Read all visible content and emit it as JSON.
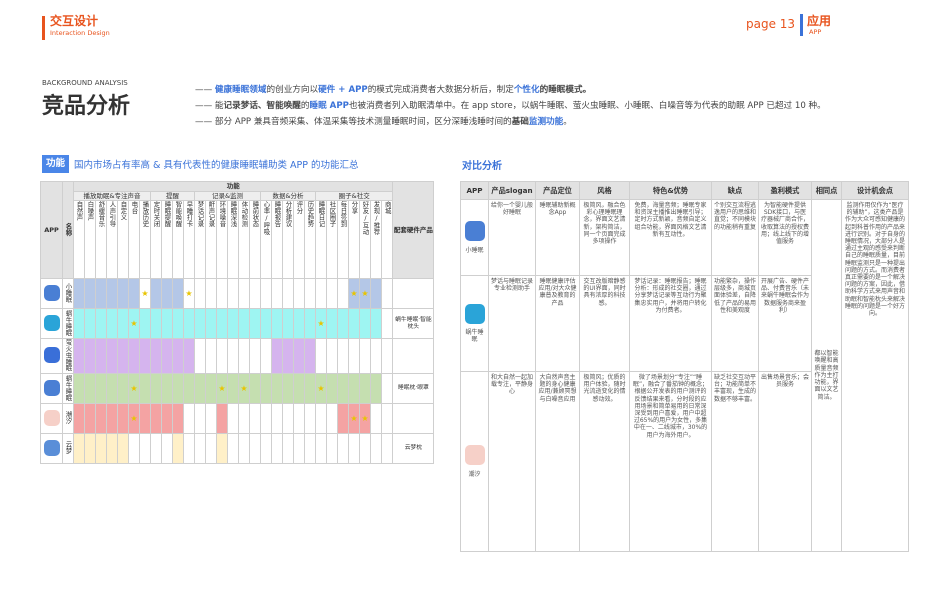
{
  "brand": {
    "title": "交互设计",
    "subtitle": "Interaction Design"
  },
  "page": {
    "label": "page 13",
    "section": "应用",
    "section_en": "APP"
  },
  "heading": {
    "en": "BACKGROUND ANALYSIS",
    "zh": "竞品分析"
  },
  "intro": {
    "l1": {
      "dash": "——",
      "p1": "健康睡眠领域",
      "p2": "的创业方向以",
      "p3": "硬件 + APP",
      "p4": "的模式完成消费者大数据分析后，制定",
      "p5": "个性化",
      "p6": "的睡眠模式。"
    },
    "l2": {
      "dash": "——",
      "p1": "能",
      "p2": "记录梦话、智能唤醒",
      "p3": "的",
      "p4": "睡眠 APP",
      "p5": "也被消费者列入助眠清单中。在 app store，以蜗牛睡眠、萤火虫睡眠、小睡眠、白噪音等为代表的助眠 APP 已超过 10 种。"
    },
    "l3": {
      "dash": "——",
      "p1": "部分 APP 兼具音频采集、体温采集等技术测量睡眠时间，区分深睡浅睡时间的",
      "p2": "基础",
      "p3": "监测功能",
      "p4": "。"
    }
  },
  "left": {
    "tag": "功能",
    "title": "国内市场占有率高 & 具有代表性的健康睡眠辅助类 APP 的功能汇总",
    "app_header": "APP",
    "name_header": "名称",
    "func_header": "功能",
    "support_header": "配套硬件产品",
    "groups": [
      "播放助眠&专注声音",
      "提醒",
      "记录&监测",
      "数据&分析",
      "圈子&社交"
    ],
    "cols": [
      "自然声",
      "白噪声",
      "舒缓音乐",
      "人声引导",
      "自定义",
      "电台",
      "播放历史",
      "定时关闭",
      "睡眠提醒",
      "智能唤醒",
      "早睡打卡",
      "梦话记录",
      "鼾声记录",
      "环境噪音",
      "睡眠深浅",
      "体动检测",
      "睡前状态",
      "心率/呼吸",
      "睡眠报告",
      "分析建议",
      "评分",
      "历史趋势",
      "睡眠日记",
      "社区圈子",
      "每日签到",
      "分享",
      "好友/互动",
      "发现/推荐",
      "商城"
    ],
    "rows": [
      {
        "name": "小睡眠",
        "support": ""
      },
      {
        "name": "蜗牛睡眠",
        "support": "蜗牛睡眠·智能枕头"
      },
      {
        "name": "萤火虫睡眠",
        "support": ""
      },
      {
        "name": "蜗牛睡眠",
        "support": "睡眠枕·眼罩"
      },
      {
        "name": "潮汐",
        "support": ""
      },
      {
        "name": "云梦",
        "support": "云梦枕"
      }
    ]
  },
  "right": {
    "title": "对比分析",
    "headers": [
      "APP",
      "产品slogan",
      "产品定位",
      "风格",
      "特色&优势",
      "缺点",
      "盈利模式",
      "相同点",
      "设计机会点"
    ],
    "rows": [
      {
        "app": "小睡眠",
        "slogan": "给你一个婴儿般好睡眠",
        "position": "睡眠辅助新概念App",
        "style": "极简风，融合色彩心理睡眠理念，界面文艺清新，架构简洁，同一个页面完成多项操作",
        "feature": "免费，海量音频；睡眠专家和资深主播推出睡眠引导；定时方式新颖，音频自定义组合功能，界面风格文艺清新有互动性。",
        "weak": "个别交互流程逃逸用户的思维和直觉；不同模块的功能稍有重复",
        "profit": "为智能硬件提供SDK接口，与医疗器械厂商合作，收取算法的授权费用；线上线下的增值服务",
        "same": "都以智能唤醒和高质量音频作为主打功能，界面以文艺简洁。",
        "chance": "监测作用仅作为“医疗的辅助”，这类产品是作为大众可感知健康的起到科普作用的产品来进行识别。对于自身的睡眠情况，大部分人是通过主观的感受来判断自己的睡眠质量，目前睡眠监测只是一种提出问题的方式。而消费者真正需要的是一个解决问题的方案，因此，借助科学方式来用声音和助眠和智能枕头来解决睡眠的问题是一个好方向。"
      },
      {
        "app": "蜗牛睡眠",
        "slogan": "梦话与睡眠记录专业检测助手",
        "position": "睡眠健康评估应用/对大众健康普及教育的产品",
        "style": "交互改版暗静感的UI界面，同时具有浓厚的科技感。",
        "feature": "梦话记录：睡眠报告；睡眠分析：形成的社交圈，通过分享梦话记录等互动行为聚集忠实用户，并将用户转化为付费者。",
        "weak": "功能繁杂，操作层级多，商城页面体验差，自降低了产品的易用性和美观度",
        "profit": "开展广告、硬件产品、付费音乐（未来蜗牛睡眠会作为数据服务商来盈利）",
        "same": "",
        "chance": ""
      },
      {
        "app": "潮汐",
        "slogan": "和大自然一起加载专注，平静身心",
        "position": "大自然声音主题的身心健康应用/兼顾冥想与白噪音应用",
        "style": "极简风；优质的用户体验，随时光流逝变化的情感动效。",
        "feature": "微了场景划分“专注”“睡眠”，融合了番茄钟的概念；根据公开发表的用户测评的反馈结果来看，分时段的应用场景和简单易用的日常深深受到用户喜爱，用户中超过65%的用户为女性，多集中在一、二线城市，30%的用户为海外用户。",
        "weak": "缺乏社交互动平台；功能简单不丰富现，生成的数据不够丰富。",
        "profit": "出售场景音乐；会员服务",
        "same": "",
        "chance": ""
      }
    ]
  },
  "colors": {
    "accent": "#e8541e",
    "blue": "#3a72d8",
    "row1": "#b4c7e7",
    "row2": "#9ef5f2",
    "row3": "#d5b4ee",
    "row4": "#c5dfb0",
    "row5": "#f4a3a3",
    "row6": "#fff0c8",
    "star": "#e8c400"
  }
}
